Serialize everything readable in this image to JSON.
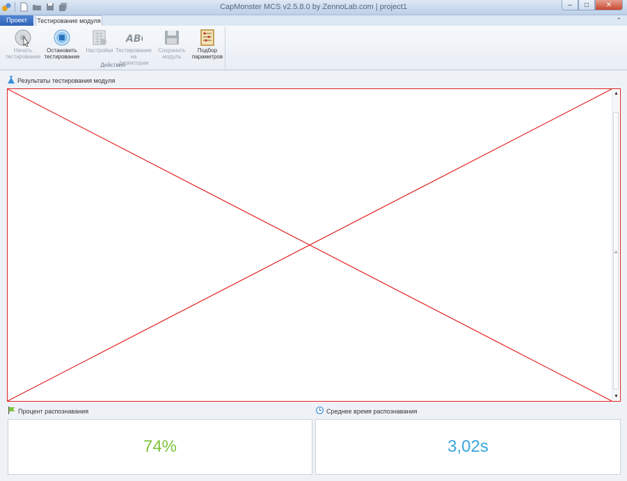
{
  "window": {
    "title": "CapMonster MCS v2.5.8.0 by ZennoLab.com | project1",
    "controls": {
      "minimize": "–",
      "maximize": "□",
      "close": "✕"
    }
  },
  "ribbon": {
    "tabs": [
      {
        "label": "Проект",
        "active": false
      },
      {
        "label": "Тестирование модуля",
        "active": true
      }
    ],
    "collapse_glyph": "⌃",
    "group_label": "Действия",
    "buttons": [
      {
        "label": "Начать\nтестирование",
        "icon": "play-disk-icon",
        "enabled": false
      },
      {
        "label": "Остановить\nтестирование",
        "icon": "stop-circle-icon",
        "enabled": true
      },
      {
        "label": "Настройки",
        "icon": "settings-grid-icon",
        "enabled": false
      },
      {
        "label": "Тестирование\nна директории",
        "icon": "abc-captcha-icon",
        "enabled": false
      },
      {
        "label": "Сохранить\nмодуль",
        "icon": "floppy-disk-icon",
        "enabled": false
      },
      {
        "label": "Подбор\nпараметров",
        "icon": "abacus-icon",
        "enabled": true
      }
    ]
  },
  "results_panel": {
    "title": "Результаты тестирования модуля",
    "icon": "flask-icon"
  },
  "stats": {
    "recognition_percent": {
      "label": "Процент распознавания",
      "value": "74%",
      "icon": "flag-icon",
      "color": "#7dc33b"
    },
    "avg_time": {
      "label": "Среднее время распознавания",
      "value": "3,02s",
      "icon": "clock-icon",
      "color": "#39a6dd"
    }
  },
  "colors": {
    "error_border": "#e02020",
    "file_tab": "#2f64b8"
  }
}
